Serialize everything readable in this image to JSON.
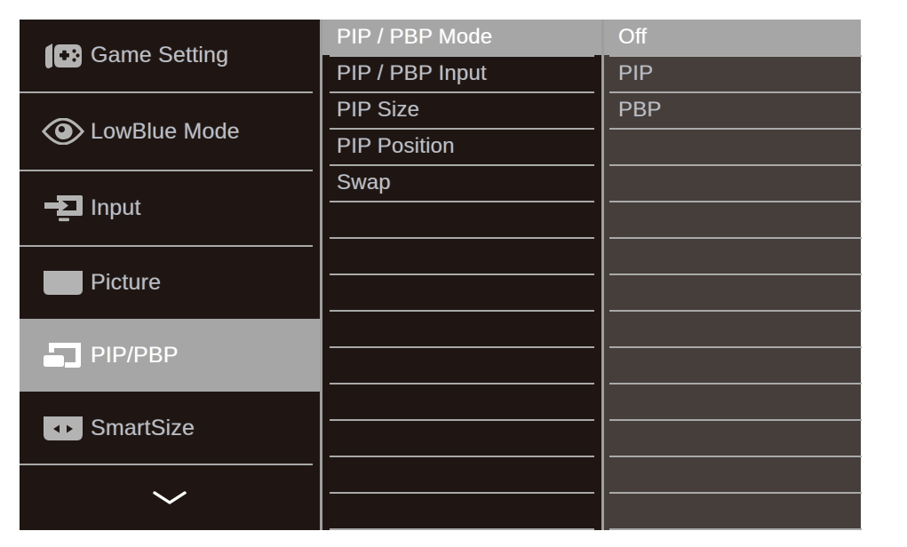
{
  "osd": {
    "sidebar": {
      "items": [
        {
          "id": "game-setting",
          "label": "Game Setting",
          "icon": "gamepad-icon",
          "selected": false
        },
        {
          "id": "lowblue-mode",
          "label": "LowBlue Mode",
          "icon": "eye-icon",
          "selected": false
        },
        {
          "id": "input",
          "label": "Input",
          "icon": "input-arrow-icon",
          "selected": false
        },
        {
          "id": "picture",
          "label": "Picture",
          "icon": "picture-icon",
          "selected": false
        },
        {
          "id": "pip-pbp",
          "label": "PIP/PBP",
          "icon": "pip-pbp-icon",
          "selected": true
        },
        {
          "id": "smartsize",
          "label": "SmartSize",
          "icon": "smartsize-icon",
          "selected": false
        }
      ],
      "scroll_more_icon": "chevron-down-icon"
    },
    "submenu": {
      "items": [
        {
          "label": "PIP / PBP Mode",
          "selected": true
        },
        {
          "label": "PIP / PBP Input",
          "selected": false
        },
        {
          "label": "PIP Size",
          "selected": false
        },
        {
          "label": "PIP Position",
          "selected": false
        },
        {
          "label": "Swap",
          "selected": false
        },
        {
          "label": "",
          "selected": false
        },
        {
          "label": "",
          "selected": false
        },
        {
          "label": "",
          "selected": false
        },
        {
          "label": "",
          "selected": false
        },
        {
          "label": "",
          "selected": false
        },
        {
          "label": "",
          "selected": false
        },
        {
          "label": "",
          "selected": false
        },
        {
          "label": "",
          "selected": false
        },
        {
          "label": "",
          "selected": false
        }
      ]
    },
    "values": {
      "items": [
        {
          "label": "Off",
          "selected": true
        },
        {
          "label": "PIP",
          "selected": false
        },
        {
          "label": "PBP",
          "selected": false
        },
        {
          "label": "",
          "selected": false
        },
        {
          "label": "",
          "selected": false
        },
        {
          "label": "",
          "selected": false
        },
        {
          "label": "",
          "selected": false
        },
        {
          "label": "",
          "selected": false
        },
        {
          "label": "",
          "selected": false
        },
        {
          "label": "",
          "selected": false
        },
        {
          "label": "",
          "selected": false
        },
        {
          "label": "",
          "selected": false
        },
        {
          "label": "",
          "selected": false
        },
        {
          "label": "",
          "selected": false
        }
      ]
    },
    "colors": {
      "panel_dark": "#1f1613",
      "panel_mid": "#463e3b",
      "highlight": "#a6a6a6",
      "divider": "#a9a9a9",
      "text": "#b8bec8",
      "text_selected": "#ffffff"
    }
  }
}
